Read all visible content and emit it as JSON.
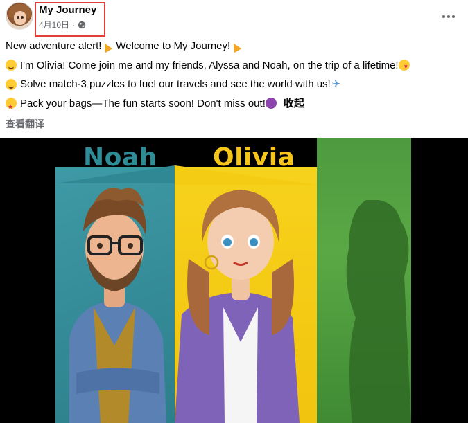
{
  "post": {
    "page_name": "My Journey",
    "date": "4月10日",
    "separator": "·",
    "more_label": "More options"
  },
  "text_lines": [
    {
      "before": "New adventure alert! ",
      "emoji1": "party-popper-icon",
      "middle": " Welcome to My Journey! ",
      "emoji2": "party-popper-icon"
    },
    {
      "emoji": "winking-face-icon",
      "text": "I'm Olivia! Come join me and my friends, Alyssa and Noah, on the trip of a lifetime! ",
      "emoji_after": "smiling-face-with-hearts-icon"
    },
    {
      "emoji": "face-with-monocle-icon",
      "text": "Solve match-3 puzzles to fuel our travels and see the world with us! ",
      "emoji_after": "airplane-icon"
    },
    {
      "emoji": "partying-face-icon",
      "text": "Pack your bags—The fun starts soon! Don't miss out! ",
      "emoji_after": "star-struck-icon",
      "see_less": "收起"
    }
  ],
  "translate_label": "查看翻译",
  "media": {
    "name_left": "Noah",
    "name_center": "Olivia",
    "colors": {
      "teal": "#2e8c96",
      "yellow": "#f5c518",
      "green": "#5aa845"
    }
  },
  "colors": {
    "highlight": "#e0403a",
    "secondary_text": "#65676b"
  }
}
